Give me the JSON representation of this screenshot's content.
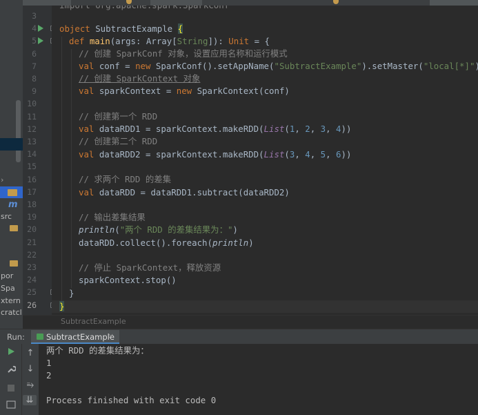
{
  "editor": {
    "top_partial_line": "import org.apache.spark.SparkConf",
    "line_numbers": [
      "3",
      "4",
      "5",
      "6",
      "7",
      "8",
      "9",
      "10",
      "11",
      "12",
      "13",
      "14",
      "15",
      "16",
      "17",
      "18",
      "19",
      "20",
      "21",
      "22",
      "23",
      "24",
      "25",
      "26"
    ],
    "current_line": "26",
    "code": {
      "l3": "",
      "l4_kw": "object ",
      "l4_name": "SubtractExample ",
      "l4_brace": "{",
      "l5_kw": "def ",
      "l5_fn": "main",
      "l5_a": "(args: Array[",
      "l5_t": "String",
      "l5_b": "]): ",
      "l5_kw2": "Unit",
      "l5_c": " = {",
      "l6": "// 创建 SparkConf 对象，设置应用名称和运行模式",
      "l7_kw": "val ",
      "l7_a": "conf = ",
      "l7_kw2": "new ",
      "l7_b": "SparkConf().setAppName(",
      "l7_s1": "\"SubtractExample\"",
      "l7_c": ").setMaster(",
      "l7_s2": "\"local[*]\"",
      "l7_d": ")",
      "l8": "// 创建 SparkContext 对象",
      "l9_kw": "val ",
      "l9_a": "sparkContext = ",
      "l9_kw2": "new ",
      "l9_b": "SparkContext(conf)",
      "l11": "// 创建第一个 RDD",
      "l12_kw": "val ",
      "l12_a": "dataRDD1 = sparkContext.makeRDD(",
      "l12_list": "List",
      "l12_p": "(",
      "l12_nums": [
        "1",
        "2",
        "3",
        "4"
      ],
      "l12_end": "))",
      "l13": "// 创建第二个 RDD",
      "l14_kw": "val ",
      "l14_a": "dataRDD2 = sparkContext.makeRDD(",
      "l14_list": "List",
      "l14_p": "(",
      "l14_nums": [
        "3",
        "4",
        "5",
        "6"
      ],
      "l14_end": "))",
      "l16": "// 求两个 RDD 的差集",
      "l17_kw": "val ",
      "l17_a": "dataRDD = dataRDD1.subtract(dataRDD2)",
      "l19": "// 输出差集结果",
      "l20_fn": "println",
      "l20_a": "(",
      "l20_s": "\"两个 RDD 的差集结果为：\"",
      "l20_b": ")",
      "l21_a": "dataRDD.collect().foreach(",
      "l21_fn": "println",
      "l21_b": ")",
      "l23": "// 停止 SparkContext，释放资源",
      "l24": "sparkContext.stop()",
      "l25": "}",
      "l26": "}"
    },
    "comma": ", ",
    "breadcrumb": "SubtractExample"
  },
  "project_panel": {
    "fragments": [
      "src",
      "por",
      "Spa",
      "xtern",
      "cratcl"
    ],
    "logo_fragment": "m"
  },
  "run_panel": {
    "label": "Run:",
    "tab": "SubtractExample",
    "tab_close": "×",
    "output": [
      "两个 RDD 的差集结果为：",
      "1",
      "2",
      "",
      "Process finished with exit code 0"
    ]
  },
  "colors": {
    "background": "#2b2b2b",
    "keyword": "#cc7832",
    "string": "#6a8759",
    "number": "#6897bb",
    "comment": "#808080",
    "function": "#ffc66d",
    "run_icon": "#59a869"
  },
  "icons": {
    "run_gutter": "run-gutter-icon",
    "rerun": "rerun-icon",
    "wrench": "wrench-icon",
    "stop": "stop-icon",
    "scroll_up": "arrow-up-icon",
    "scroll_down": "arrow-down-icon",
    "soft_wrap": "soft-wrap-icon",
    "scroll_end": "scroll-to-end-icon"
  }
}
